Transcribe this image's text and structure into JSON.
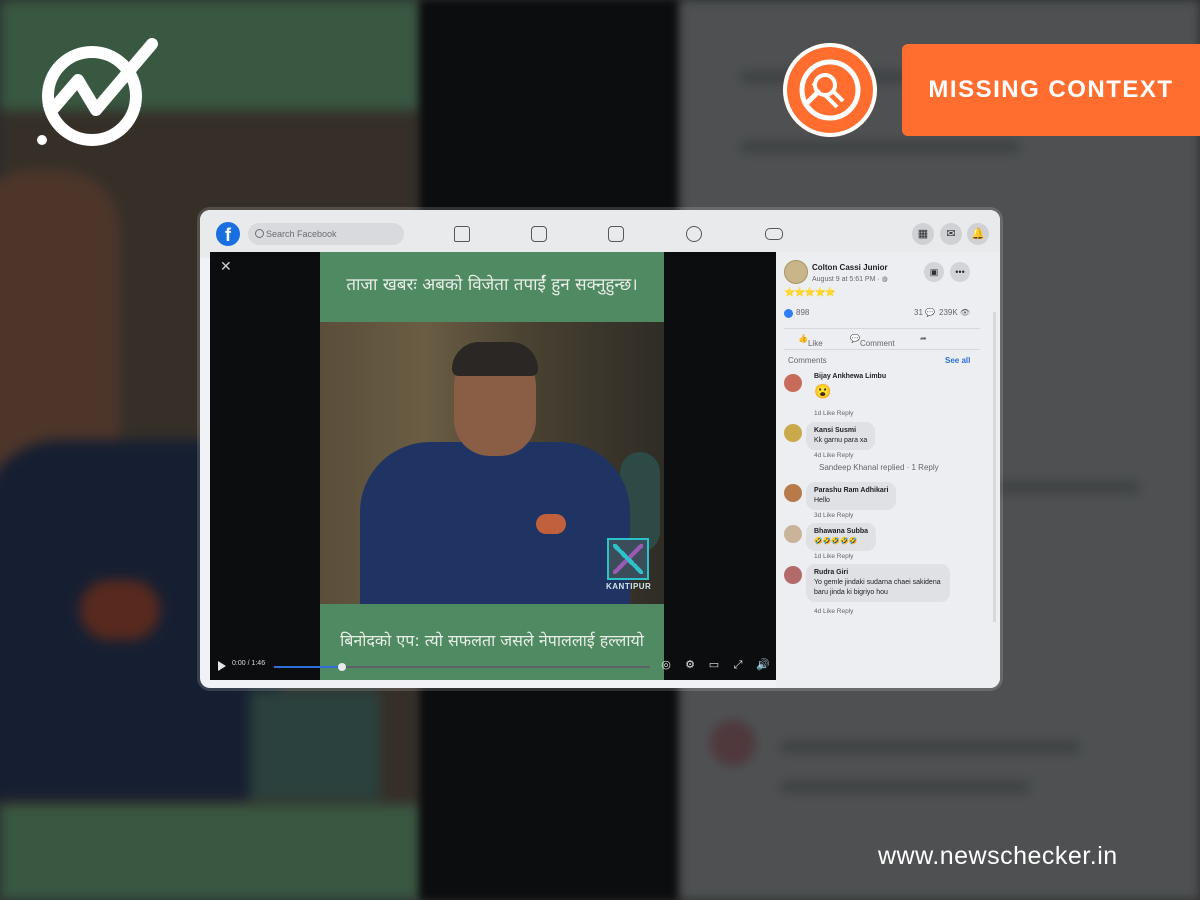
{
  "badge": {
    "label": "MISSING CONTEXT"
  },
  "site": {
    "url": "www.newschecker.in"
  },
  "facebook": {
    "search_placeholder": "Search Facebook"
  },
  "video": {
    "headline_top": "ताजा खबरः अबको विजेता तपाईं हुन सक्नुहुन्छ।",
    "headline_bottom": "बिनोदको एप: त्यो सफलता जसले नेपाललाई हल्लायो",
    "watermark": "KANTIPUR",
    "time": "0:00 / 1:46",
    "progress": 0.18
  },
  "post": {
    "author": "Colton Cassi Junior",
    "date": "August 9 at 5:61 PM · ",
    "stars": "⭐⭐⭐⭐⭐",
    "likes": "898",
    "comments_count": "31",
    "views": "239K",
    "like_label": "Like",
    "comment_label": "Comment"
  },
  "comments": {
    "header": "Comments",
    "see_all": "See all",
    "items": [
      {
        "name": "Bijay Ankhewa Limbu",
        "text": "😮",
        "meta": "1d  Like  Reply"
      },
      {
        "name": "Kansi Susmi",
        "text": "Kk garnu para xa",
        "meta": "4d  Like  Reply"
      },
      {
        "name": "Parashu Ram Adhikari",
        "text": "Hello",
        "meta": "3d  Like  Reply"
      },
      {
        "name": "Bhawana Subba",
        "text": "🤣🤣🤣🤣🤣",
        "meta": "1d  Like  Reply"
      },
      {
        "name": "Rudra Giri",
        "text": "Yo gemle jindaki sudarna chaei sakidena baru jinda ki bigriyo hou",
        "meta": "4d  Like  Reply"
      }
    ],
    "reply_summary": "Sandeep Khanal replied · 1 Reply"
  },
  "colors": {
    "badge": "#ff6e2e",
    "fb_blue": "#1a6fe0",
    "video_band": "#4f8a63"
  }
}
